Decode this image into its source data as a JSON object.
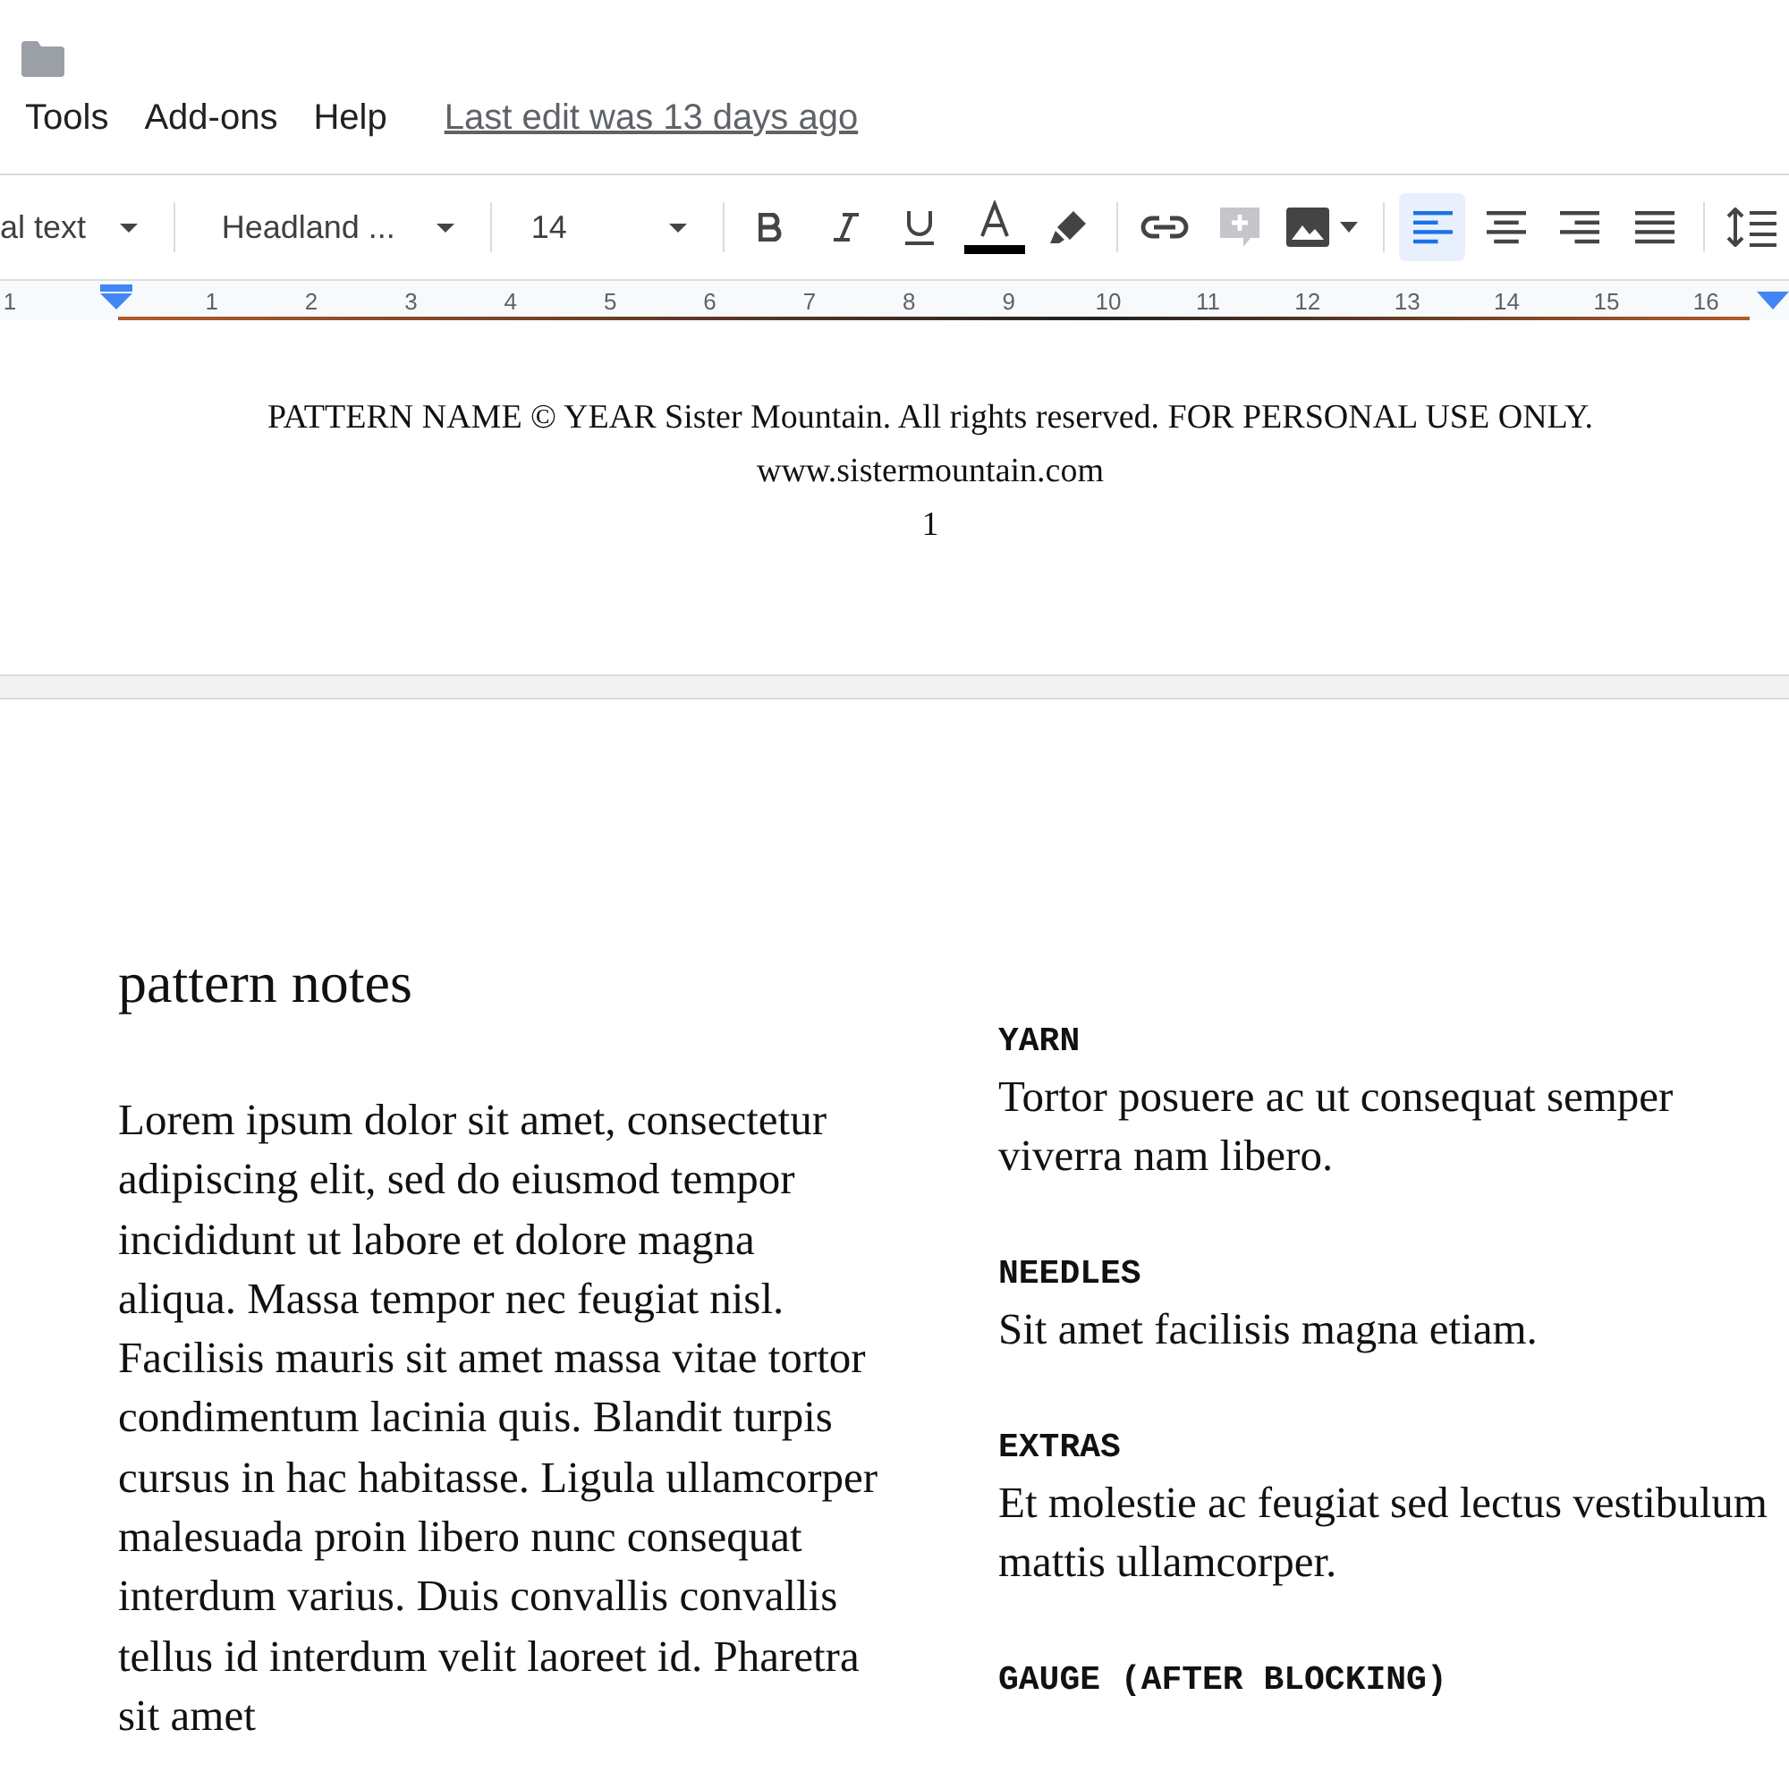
{
  "menu": [
    {
      "label": "Tools"
    },
    {
      "label": "Add-ons"
    },
    {
      "label": "Help"
    }
  ],
  "last_edit": "Last edit was 13 days ago",
  "toolbar": {
    "style": "al text",
    "font": "Headland ...",
    "size": "14",
    "align": [
      {
        "kind": "left",
        "selected": true
      },
      {
        "kind": "center",
        "selected": false
      },
      {
        "kind": "right",
        "selected": false
      },
      {
        "kind": "justify",
        "selected": false
      }
    ]
  },
  "ruler": [
    "1",
    "1",
    "2",
    "3",
    "4",
    "5",
    "6",
    "7",
    "8",
    "9",
    "10",
    "11",
    "12",
    "13",
    "14",
    "15",
    "16"
  ],
  "footer": [
    "PATTERN NAME © YEAR Sister Mountain. All rights reserved. FOR PERSONAL USE ONLY.",
    "www.sistermountain.com",
    "1"
  ],
  "page": {
    "heading": "pattern notes",
    "body": "Lorem ipsum dolor sit amet, consectetur adipiscing elit, sed do eiusmod tempor incididunt ut labore et dolore magna aliqua. Massa tempor nec feugiat nisl. Facilisis mauris sit amet massa vitae tortor condimentum lacinia quis. Blandit turpis cursus in hac habitasse. Ligula ullamcorper malesuada proin libero nunc consequat interdum varius. Duis convallis convallis tellus id interdum velit laoreet id. Pharetra sit amet",
    "sections": [
      {
        "title": "YARN",
        "text": "Tortor posuere ac ut consequat semper viverra nam libero."
      },
      {
        "title": "NEEDLES",
        "text": "Sit amet facilisis magna etiam."
      },
      {
        "title": "EXTRAS",
        "text": "Et molestie ac feugiat sed lectus vestibulum mattis ullamcorper."
      },
      {
        "title": "GAUGE (AFTER BLOCKING)"
      }
    ]
  }
}
